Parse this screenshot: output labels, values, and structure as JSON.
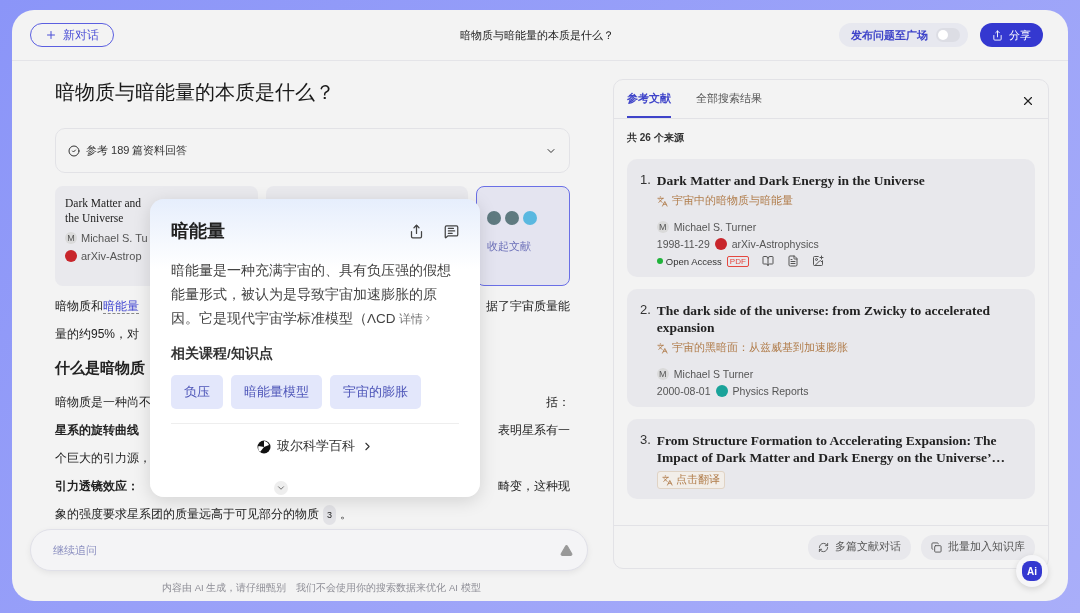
{
  "header": {
    "new_chat": "新对话",
    "title": "暗物质与暗能量的本质是什么？",
    "publish": {
      "label": "发布问题至广场",
      "on": false
    },
    "share": "分享"
  },
  "main": {
    "question": "暗物质与暗能量的本质是什么？",
    "sources_summary": "参考 189 篇资料回答",
    "source_cards": [
      {
        "kind": "paper",
        "title": "Dark Matter and",
        "title_line2": "the Universe",
        "author_initial": "M",
        "author": "Michael S. Tu",
        "source": "arXiv-Astrop"
      },
      {
        "kind": "paper"
      },
      {
        "kind": "collapse",
        "label": "收起文献"
      }
    ],
    "lines": [
      {
        "kind": "text",
        "left": "暗物质和",
        "link": "暗能量",
        "right": "据了宇宙质量能"
      },
      {
        "kind": "text",
        "left": "量的约95%，对"
      },
      {
        "kind": "heading",
        "left": "什么是暗物质"
      },
      {
        "kind": "text",
        "left": "暗物质是一种尚不",
        "right": "括："
      },
      {
        "kind": "text",
        "bold": "星系的旋转曲线",
        "right": "表明星系有一"
      },
      {
        "kind": "text",
        "left": "个巨大的引力源，"
      },
      {
        "kind": "text",
        "bold": "引力透镜效应：",
        "right": "畸变，这种现"
      },
      {
        "kind": "text",
        "left": "象的强度要求星系团的质量远高于可见部分的物质",
        "cite": "3",
        "tail": "。"
      }
    ],
    "input": {
      "placeholder": "继续追问"
    },
    "footer": [
      "内容由 AI 生成，请仔细甄别",
      "我们不会使用你的搜索数据来优化 AI 模型"
    ]
  },
  "popup": {
    "title": "暗能量",
    "body": "暗能量是一种充满宇宙的、具有负压强的假想能量形式，被认为是导致宇宙加速膨胀的原因。它是现代宇宙学标准模型（ΛCD",
    "more": "详情",
    "related_title": "相关课程/知识点",
    "tags": [
      "负压",
      "暗能量模型",
      "宇宙的膨胀"
    ],
    "wiki": "玻尔科学百科"
  },
  "references": {
    "tabs": [
      {
        "label": "参考文献",
        "selected": true
      },
      {
        "label": "全部搜索结果",
        "selected": false
      }
    ],
    "count": "共 26 个来源",
    "items": [
      {
        "number": "1.",
        "title": "Dark Matter and Dark Energy in the Universe",
        "translation": "宇宙中的暗物质与暗能量",
        "author": "Michael S. Turner",
        "date": "1998-11-29",
        "source": "arXiv-Astrophysics",
        "color": "#c8262c",
        "author_initial": "M",
        "open_access": "Open Access",
        "pdf": "PDF"
      },
      {
        "number": "2.",
        "title": "The dark side of the universe: from Zwicky to accelerated expansion",
        "translation": "宇宙的黑暗面：从兹威基到加速膨胀",
        "author": "Michael S Turner",
        "date": "2000-08-01",
        "source": "Physics Reports",
        "color": "#1aa39a",
        "author_initial": "M"
      },
      {
        "number": "3.",
        "title": "From Structure Formation to Accelerating Expansion: The Impact of Dark Matter and Dark Energy on the Universe’…",
        "translate_button": "点击翻译"
      }
    ],
    "actions": [
      "多篇文献对话",
      "批量加入知识库"
    ]
  },
  "assistant_badge": "Ai"
}
